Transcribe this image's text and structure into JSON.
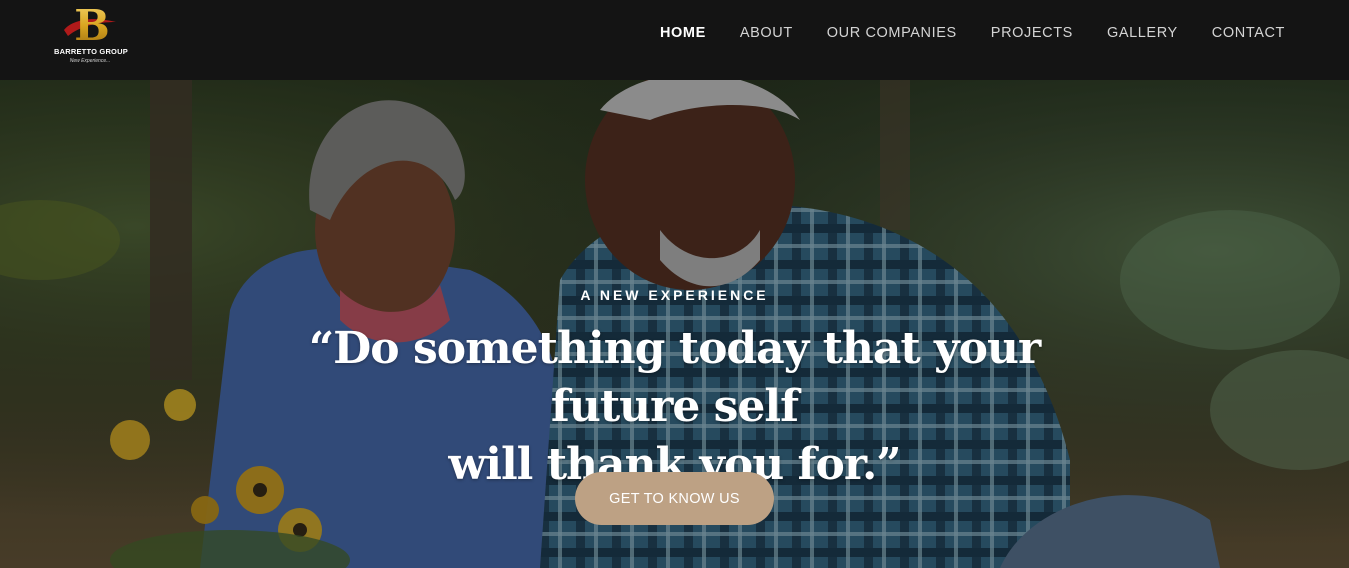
{
  "brand": {
    "name": "BARRETTO GROUP",
    "tagline": "New Experience...",
    "logo_letter": "B"
  },
  "nav": {
    "items": [
      {
        "label": "HOME",
        "active": true
      },
      {
        "label": "ABOUT",
        "active": false
      },
      {
        "label": "OUR COMPANIES",
        "active": false
      },
      {
        "label": "PROJECTS",
        "active": false
      },
      {
        "label": "GALLERY",
        "active": false
      },
      {
        "label": "CONTACT",
        "active": false
      }
    ]
  },
  "hero": {
    "kicker": "A NEW EXPERIENCE",
    "quote_line1": "“Do something today that your future self",
    "quote_line2": "will thank you for.”",
    "cta_label": "GET TO KNOW US"
  },
  "colors": {
    "header_bg": "#141414",
    "cta_bg": "#bda184",
    "logo_gold": "#d9a520",
    "logo_red": "#b01a1a"
  }
}
